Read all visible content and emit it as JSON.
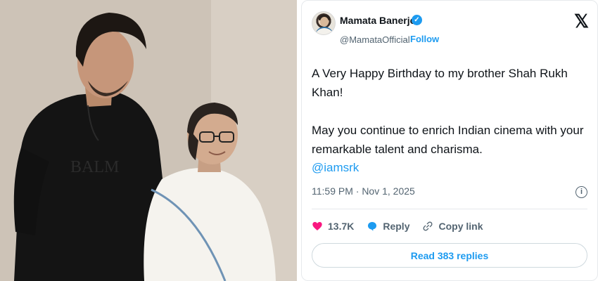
{
  "tweet": {
    "author_name": "Mamata Banerjee",
    "handle": "@MamataOfficial",
    "separator": "·",
    "follow_label": "Follow",
    "platform_logo": "𝕏",
    "text_line1": "A Very Happy Birthday to my brother Shah Rukh Khan!",
    "text_line2": "May you continue to enrich Indian cinema with your remarkable talent and charisma.",
    "mention": "@iamsrk",
    "timestamp": "11:59 PM · Nov 1, 2025",
    "likes_count": "13.7K",
    "reply_label": "Reply",
    "copy_link_label": "Copy link",
    "read_replies_label": "Read 383 replies"
  },
  "photo": {
    "shirt_print": "BALM"
  },
  "icons": {
    "verified": "check-badge-icon",
    "info": "info-icon",
    "like": "heart-icon",
    "reply": "speech-bubble-icon",
    "copy_link": "link-icon"
  },
  "colors": {
    "accent": "#1d9bf0",
    "like": "#f91880",
    "text": "#0f1419",
    "muted": "#536471"
  }
}
